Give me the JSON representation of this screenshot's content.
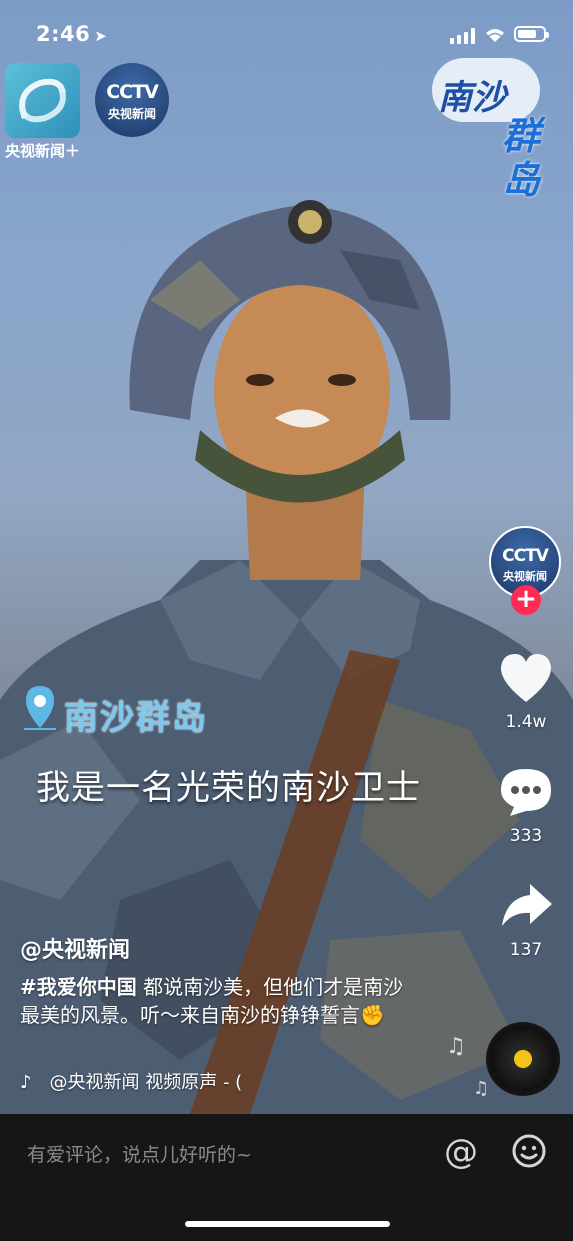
{
  "status_bar": {
    "time": "2:46",
    "battery_level": 0.65
  },
  "logos": {
    "left_app_label": "央视新闻＋",
    "cctv_text": "CCTV",
    "cctv_sub": "央视新闻"
  },
  "title_stamp": {
    "line1": "南沙",
    "line2": "群岛"
  },
  "video": {
    "location": "南沙群岛",
    "subtitle": "我是一名光荣的南沙卫士"
  },
  "right_rail": {
    "avatar_text": "CCTV",
    "avatar_sub": "央视新闻",
    "follow_symbol": "+",
    "likes": "1.4w",
    "comments": "333",
    "shares": "137"
  },
  "post": {
    "author": "@央视新闻",
    "hashtag": "#我爱你中国",
    "caption": " 都说南沙美，但他们才是南沙最美的风景。听～来自南沙的铮铮誓言✊",
    "music": "@央视新闻    视频原声 - ("
  },
  "comment_bar": {
    "placeholder": "有爱评论，说点儿好听的~",
    "at_symbol": "@"
  },
  "colors": {
    "follow_red": "#fe2c55",
    "disc_dot": "#f2c318",
    "location_blue": "#7ec8f0"
  }
}
